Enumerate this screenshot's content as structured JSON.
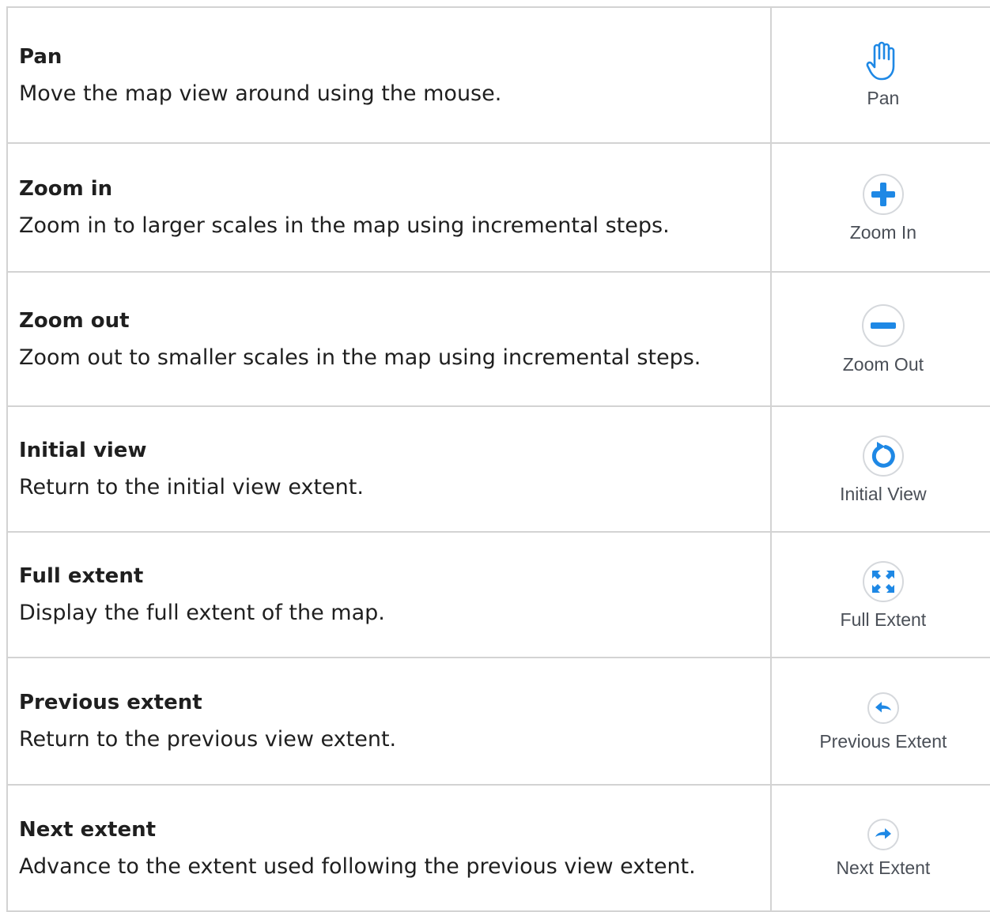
{
  "accent_color": "#1e88e5",
  "tools": [
    {
      "title": "Pan",
      "description": "Move the map view around using the mouse.",
      "label": "Pan",
      "icon": "hand-pan-icon"
    },
    {
      "title": "Zoom in",
      "description": "Zoom in to larger scales in the map using incremental steps.",
      "label": "Zoom In",
      "icon": "zoom-in-icon"
    },
    {
      "title": "Zoom out",
      "description": "Zoom out to smaller scales in the map using incremental steps.",
      "label": "Zoom Out",
      "icon": "zoom-out-icon"
    },
    {
      "title": "Initial view",
      "description": "Return to the initial view extent.",
      "label": "Initial View",
      "icon": "initial-view-icon"
    },
    {
      "title": "Full extent",
      "description": "Display the full extent of the map.",
      "label": "Full Extent",
      "icon": "full-extent-icon"
    },
    {
      "title": "Previous extent",
      "description": "Return to the previous view extent.",
      "label": "Previous Extent",
      "icon": "previous-extent-icon"
    },
    {
      "title": "Next extent",
      "description": "Advance to the extent used following the previous view extent.",
      "label": "Next Extent",
      "icon": "next-extent-icon"
    }
  ]
}
